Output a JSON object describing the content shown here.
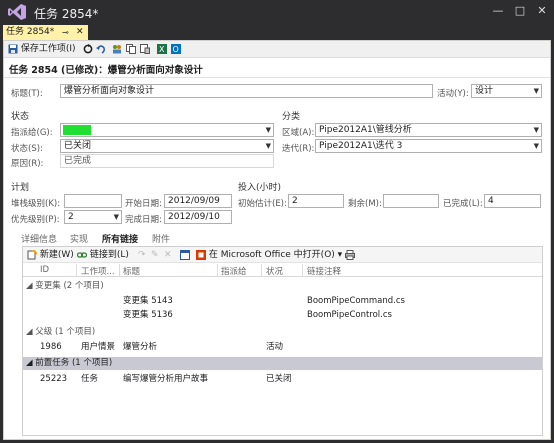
{
  "window": {
    "title": "任务 2854*",
    "minimize_glyph": "—",
    "maximize_glyph": "□",
    "close_glyph": "✕"
  },
  "tab": {
    "label": "任务 2854*",
    "pin_glyph": "⊸",
    "close_glyph": "✕"
  },
  "toolbar": {
    "save_label": "保存工作项(I)",
    "icons": [
      "save-icon",
      "refresh-icon",
      "undo-icon",
      "user-group-icon",
      "copy-icon",
      "link-icon",
      "excel-icon",
      "outlook-icon"
    ]
  },
  "workitem": {
    "heading": "任务 2854 (已修改)：爆管分析面向对象设计"
  },
  "fields": {
    "title_label": "标题(T):",
    "title_value": "爆管分析面向对象设计",
    "activity_label": "活动(Y):",
    "activity_value": "设计",
    "status_section": "状态",
    "assigned_label": "指派给(G):",
    "assigned_value": "",
    "state_label": "状态(S):",
    "state_value": "已关闭",
    "reason_label": "原因(R):",
    "reason_value": "已完成",
    "classification_section": "分类",
    "area_label": "区域(A):",
    "area_value": "Pipe2012A1\\管线分析",
    "iteration_label": "迭代(R):",
    "iteration_value": "Pipe2012A1\\迭代 3",
    "plan_section": "计划",
    "stack_rank_label": "堆栈级别(K):",
    "stack_rank_value": "",
    "start_date_label": "开始日期:",
    "start_date_value": "2012/09/09",
    "priority_label": "优先级别(P):",
    "priority_value": "2",
    "finish_date_label": "完成日期:",
    "finish_date_value": "2012/09/10",
    "effort_section": "投入(小时)",
    "original_estimate_label": "初始估计(E):",
    "original_estimate_value": "2",
    "remaining_label": "剩余(M):",
    "remaining_value": "",
    "completed_label": "已完成(L):",
    "completed_value": "4"
  },
  "subtabs": [
    "详细信息",
    "实现",
    "所有链接",
    "附件"
  ],
  "active_subtab": "所有链接",
  "links_toolbar": {
    "new_label": "新建(W)",
    "link_to_label": "链接到(L)",
    "open_office_label": "在 Microsoft Office 中打开(O)"
  },
  "columns": [
    "ID",
    "工作项...",
    "标题",
    "指派给",
    "状况",
    "链接注释"
  ],
  "groups": [
    {
      "label": "变更集 (2 个项目)",
      "rows": [
        {
          "id": "",
          "type": "",
          "title": "变更集 5143",
          "assigned": "",
          "state": "",
          "comment": "BoomPipeCommand.cs"
        },
        {
          "id": "",
          "type": "",
          "title": "变更集 5136",
          "assigned": "",
          "state": "",
          "comment": "BoomPipeControl.cs"
        }
      ]
    },
    {
      "label": "父级 (1 个项目)",
      "rows": [
        {
          "id": "1986",
          "type": "用户情景",
          "title": "爆管分析",
          "assigned": "",
          "state": "活动",
          "comment": ""
        }
      ]
    },
    {
      "label": "前置任务 (1 个项目)",
      "rows": [
        {
          "id": "25223",
          "type": "任务",
          "title": "编写爆管分析用户故事",
          "assigned": "",
          "state": "已关闭",
          "comment": ""
        }
      ]
    }
  ],
  "colors": {
    "accent": "#68217a",
    "tab_active": "#fff1a8",
    "assigned_highlight": "#22e032",
    "selected_group": "#c9c9d4"
  }
}
